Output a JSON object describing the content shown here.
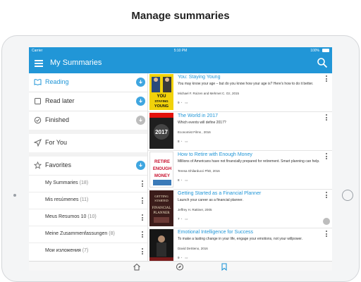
{
  "caption": "Manage summaries",
  "status_bar": {
    "carrier": "Carrier",
    "time": "5:10 PM",
    "battery": "100%"
  },
  "app_bar": {
    "title": "My Summaries"
  },
  "sidebar": {
    "items": [
      {
        "label": "Reading",
        "active": true,
        "icon": "book-open-icon"
      },
      {
        "label": "Read later",
        "icon": "clock-icon"
      },
      {
        "label": "Finished",
        "icon": "check-circle-icon"
      },
      {
        "label": "For You",
        "icon": "send-icon"
      },
      {
        "label": "Favorites",
        "icon": "star-icon"
      }
    ],
    "favorites": [
      {
        "name": "My Summaries",
        "count": "(18)"
      },
      {
        "name": "Mis resúmenes",
        "count": "(11)"
      },
      {
        "name": "Meus Resumos 10",
        "count": "(10)"
      },
      {
        "name": "Meine Zusammenfassungen",
        "count": "(8)"
      },
      {
        "name": "Мои изложения",
        "count": "(7)"
      }
    ]
  },
  "summaries": [
    {
      "title": "You: Staying Young",
      "description": "You may know your age – but do you know how your age is? Here's how to do it better.",
      "author": "Michael F. Roizen and Mehmet C. Oz, 2015",
      "rating": "9",
      "cover_text": [
        "YOU",
        "STAYING",
        "YOUNG"
      ],
      "cover_bg": "#f1d20a"
    },
    {
      "title": "The World in 2017",
      "description": "Which events will define 2017?",
      "author": "Economist Films , 2016",
      "rating": "8",
      "cover_text": [
        "2017"
      ],
      "cover_bg": "#1f1f1f"
    },
    {
      "title": "How to Retire with Enough Money",
      "description": "Millions of Americans have not financially prepared for retirement. Smart planning can help.",
      "author": "Teresa Ghilarducci PhD, 2016",
      "rating": "8",
      "cover_text": [
        "RETIRE",
        "ENOUGH",
        "MONEY"
      ],
      "cover_bg": "#ffffff"
    },
    {
      "title": "Getting Started as a Financial Planner",
      "description": "Launch your career as a financial planner.",
      "author": "Jeffrey H. Rattiner, 2005",
      "rating": "7",
      "cover_text": [
        "GETTING",
        "STARTED",
        "FINANCIAL",
        "PLANNER"
      ],
      "cover_bg": "#3b1c1a"
    },
    {
      "title": "Emotional Intelligence for Success",
      "description": "To make a lasting change in your life, engage your emotions, not your willpower.",
      "author": "David DeSteno, 2016",
      "rating": "9",
      "cover_text": [],
      "cover_bg": "#161616"
    }
  ],
  "tabbar": {
    "icons": [
      "home-icon",
      "compass-icon",
      "bookmark-icon"
    ]
  },
  "colors": {
    "accent": "#2196d7",
    "divider": "#e4e4e4"
  }
}
